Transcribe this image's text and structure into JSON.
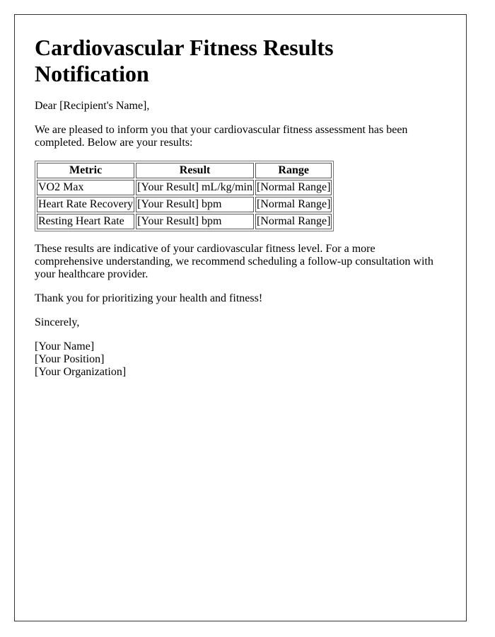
{
  "title": "Cardiovascular Fitness Results Notification",
  "greeting": "Dear [Recipient's Name],",
  "intro": "We are pleased to inform you that your cardiovascular fitness assessment has been completed. Below are your results:",
  "table": {
    "headers": [
      "Metric",
      "Result",
      "Range"
    ],
    "rows": [
      [
        "VO2 Max",
        "[Your Result] mL/kg/min",
        "[Normal Range]"
      ],
      [
        "Heart Rate Recovery",
        "[Your Result] bpm",
        "[Normal Range]"
      ],
      [
        "Resting Heart Rate",
        "[Your Result] bpm",
        "[Normal Range]"
      ]
    ]
  },
  "body": "These results are indicative of your cardiovascular fitness level. For a more comprehensive understanding, we recommend scheduling a follow-up consultation with your healthcare provider.",
  "thanks": "Thank you for prioritizing your health and fitness!",
  "closing": "Sincerely,",
  "signature": {
    "name": "[Your Name]",
    "position": "[Your Position]",
    "organization": "[Your Organization]"
  }
}
